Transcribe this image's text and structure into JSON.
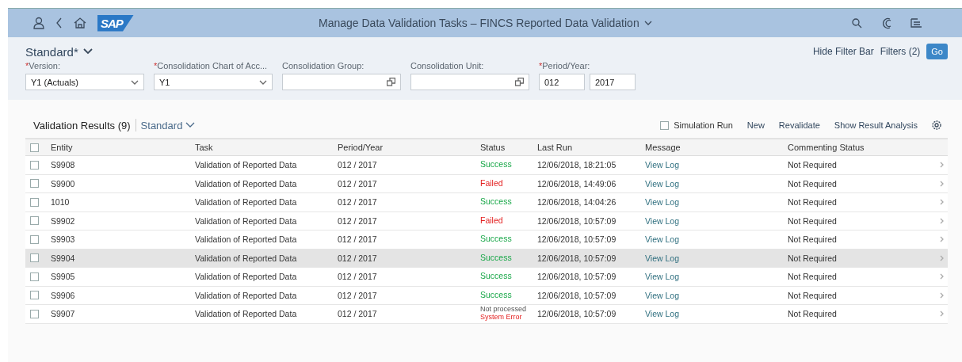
{
  "shell": {
    "title": "Manage Data Validation Tasks – FINCS Reported Data Validation",
    "logo": "SAP"
  },
  "filter_bar": {
    "variant": "Standard*",
    "hide_filter_bar": "Hide Filter Bar",
    "filters": "Filters (2)",
    "go": "Go",
    "fields": [
      {
        "required_mark": "*",
        "label": "Version:",
        "kind": "dropdown",
        "values": [
          "Y1 (Actuals)"
        ]
      },
      {
        "required_mark": "*",
        "label": "Consolidation Chart of Acc...",
        "kind": "dropdown",
        "values": [
          "Y1"
        ]
      },
      {
        "label": "Consolidation Group:",
        "kind": "valuehelp"
      },
      {
        "label": "Consolidation Unit:",
        "kind": "valuehelp"
      },
      {
        "required_mark": "*",
        "label": "Period/Year:",
        "kind": "pair",
        "values": [
          "012",
          "2017"
        ]
      }
    ]
  },
  "table": {
    "title": "Validation Results (9)",
    "variant": "Standard",
    "toolbar": {
      "simulation_run": {
        "label": "Simulation Run",
        "checked": false
      },
      "actions": [
        "New",
        "Revalidate",
        "Show Result Analysis"
      ]
    },
    "columns": [
      "Entity",
      "Task",
      "Period/Year",
      "Status",
      "Last Run",
      "Message",
      "Commenting Status"
    ],
    "all_selected": false,
    "rows": [
      {
        "entity": "S9908",
        "task": "Validation of Reported Data",
        "period": "012 / 2017",
        "status": [
          {
            "text": "Success",
            "kind": "success"
          }
        ],
        "last_run": "12/06/2018, 18:21:05",
        "message": "View Log",
        "commenting": "Not Required",
        "selected": false,
        "hovered": false
      },
      {
        "entity": "S9900",
        "task": "Validation of Reported Data",
        "period": "012 / 2017",
        "status": [
          {
            "text": "Failed",
            "kind": "error"
          }
        ],
        "last_run": "12/06/2018, 14:49:06",
        "message": "View Log",
        "commenting": "Not Required",
        "selected": false,
        "hovered": false
      },
      {
        "entity": "1010",
        "task": "Validation of Reported Data",
        "period": "012 / 2017",
        "status": [
          {
            "text": "Success",
            "kind": "success"
          }
        ],
        "last_run": "12/06/2018, 14:04:26",
        "message": "View Log",
        "commenting": "Not Required",
        "selected": false,
        "hovered": false
      },
      {
        "entity": "S9902",
        "task": "Validation of Reported Data",
        "period": "012 / 2017",
        "status": [
          {
            "text": "Failed",
            "kind": "error"
          }
        ],
        "last_run": "12/06/2018, 10:57:09",
        "message": "View Log",
        "commenting": "Not Required",
        "selected": false,
        "hovered": false
      },
      {
        "entity": "S9903",
        "task": "Validation of Reported Data",
        "period": "012 / 2017",
        "status": [
          {
            "text": "Success",
            "kind": "success"
          }
        ],
        "last_run": "12/06/2018, 10:57:09",
        "message": "View Log",
        "commenting": "Not Required",
        "selected": false,
        "hovered": false
      },
      {
        "entity": "S9904",
        "task": "Validation of Reported Data",
        "period": "012 / 2017",
        "status": [
          {
            "text": "Success",
            "kind": "success"
          }
        ],
        "last_run": "12/06/2018, 10:57:09",
        "message": "View Log",
        "commenting": "Not Required",
        "selected": false,
        "hovered": true
      },
      {
        "entity": "S9905",
        "task": "Validation of Reported Data",
        "period": "012 / 2017",
        "status": [
          {
            "text": "Success",
            "kind": "success"
          }
        ],
        "last_run": "12/06/2018, 10:57:09",
        "message": "View Log",
        "commenting": "Not Required",
        "selected": false,
        "hovered": false
      },
      {
        "entity": "S9906",
        "task": "Validation of Reported Data",
        "period": "012 / 2017",
        "status": [
          {
            "text": "Success",
            "kind": "success"
          }
        ],
        "last_run": "12/06/2018, 10:57:09",
        "message": "View Log",
        "commenting": "Not Required",
        "selected": false,
        "hovered": false
      },
      {
        "entity": "S9907",
        "task": "Validation of Reported Data",
        "period": "012 / 2017",
        "status": [
          {
            "text": "Not processed",
            "kind": "neutral"
          },
          {
            "text": "System Error",
            "kind": "error"
          }
        ],
        "last_run": "12/06/2018, 10:57:09",
        "message": "View Log",
        "commenting": "Not Required",
        "selected": false,
        "hovered": false
      }
    ]
  }
}
